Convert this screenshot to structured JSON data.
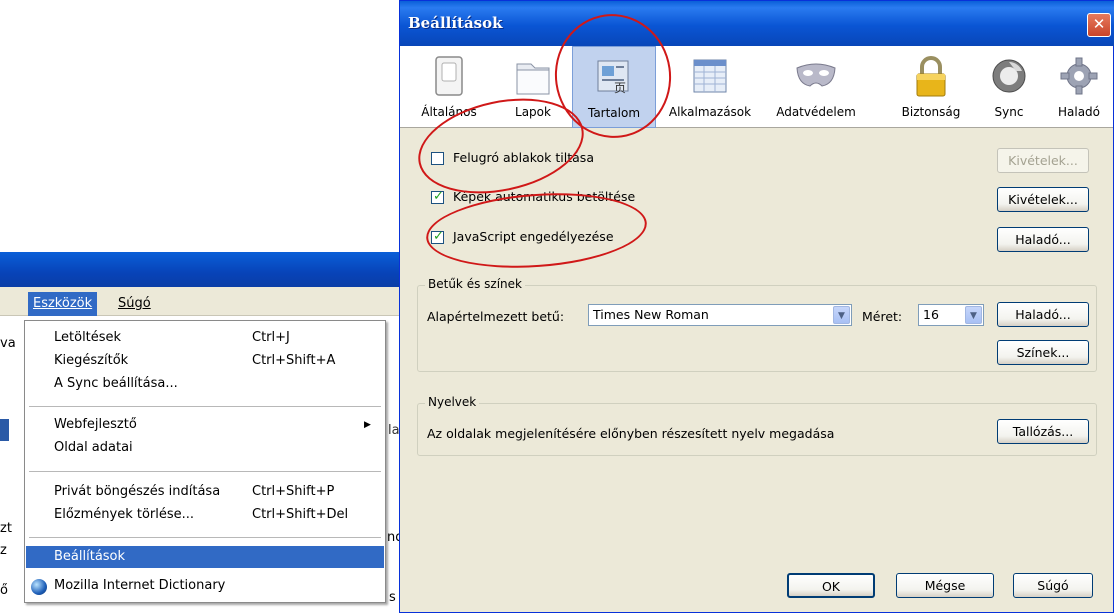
{
  "background_window": {
    "menubar": {
      "tools": "Eszközök",
      "help": "Súgó"
    },
    "side_fragments": [
      "va",
      "la",
      "zt",
      "z",
      "ő",
      "nd",
      "s"
    ],
    "tools_menu": [
      {
        "label": "Letöltések",
        "shortcut": "Ctrl+J"
      },
      {
        "label": "Kiegészítők",
        "shortcut": "Ctrl+Shift+A"
      },
      {
        "label": "A Sync beállítása...",
        "shortcut": ""
      },
      {
        "label": "Webfejlesztő",
        "shortcut": ""
      },
      {
        "label": "Oldal adatai",
        "shortcut": ""
      },
      {
        "label": "Privát böngészés indítása",
        "shortcut": "Ctrl+Shift+P"
      },
      {
        "label": "Előzmények törlése...",
        "shortcut": "Ctrl+Shift+Del"
      },
      {
        "label": "Beállítások",
        "shortcut": ""
      },
      {
        "label": "Mozilla Internet Dictionary",
        "shortcut": ""
      }
    ]
  },
  "dialog": {
    "title": "Beállítások",
    "close": "✕",
    "panes": [
      "Általános",
      "Lapok",
      "Tartalom",
      "Alkalmazások",
      "Adatvédelem",
      "Biztonság",
      "Sync",
      "Haladó"
    ],
    "selected_pane": "Tartalom",
    "content": {
      "popups": {
        "label": "Felugró ablakok tiltása",
        "checked": false,
        "button": "Kivételek..."
      },
      "images": {
        "label": "Képek automatikus betöltése",
        "checked": true,
        "button": "Kivételek..."
      },
      "javascript": {
        "label": "JavaScript engedélyezése",
        "checked": true,
        "button": "Haladó..."
      },
      "fonts_group": {
        "title": "Betűk és színek",
        "default_font_label": "Alapértelmezett betű:",
        "default_font_value": "Times New Roman",
        "size_label": "Méret:",
        "size_value": "16",
        "advanced_button": "Haladó...",
        "colors_button": "Színek..."
      },
      "languages_group": {
        "title": "Nyelvek",
        "description": "Az oldalak megjelenítésére előnyben részesített nyelv megadása",
        "browse_button": "Tallózás..."
      }
    },
    "footer": {
      "ok": "OK",
      "cancel": "Mégse",
      "help": "Súgó"
    }
  },
  "colors": {
    "titlebar": "#0a55d4",
    "selection": "#316ac5",
    "dialog_bg": "#ece9d8",
    "highlight_circle": "#d01818"
  }
}
